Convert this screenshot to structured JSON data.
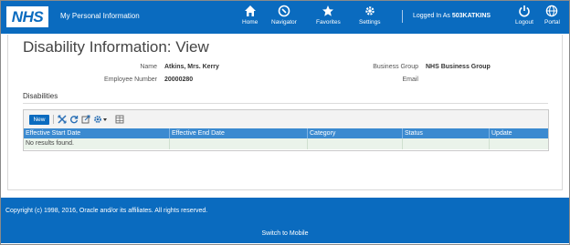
{
  "header": {
    "logo_text": "NHS",
    "app_title": "My Personal Information",
    "nav": [
      {
        "label": "Home",
        "icon": "home-icon"
      },
      {
        "label": "Navigator",
        "icon": "navigator-icon"
      },
      {
        "label": "Favorites",
        "icon": "favorites-star-icon"
      },
      {
        "label": "Settings",
        "icon": "settings-gear-icon"
      }
    ],
    "logged_in_prefix": "Logged In As",
    "username": "503KATKINS",
    "logout_label": "Logout",
    "portal_label": "Portal"
  },
  "page": {
    "title": "Disability Information: View",
    "fields": {
      "name_label": "Name",
      "name_value": "Atkins, Mrs. Kerry",
      "employee_number_label": "Employee Number",
      "employee_number_value": "20000280",
      "business_group_label": "Business Group",
      "business_group_value": "NHS Business Group",
      "email_label": "Email",
      "email_value": ""
    },
    "section_title": "Disabilities",
    "toolbar": {
      "new_label": "New",
      "icons": [
        "detach-icon",
        "refresh-icon",
        "export-icon",
        "actions-gear-icon",
        "columns-icon"
      ]
    },
    "table": {
      "columns": [
        "Effective Start Date",
        "Effective End Date",
        "Category",
        "Status",
        "Update"
      ],
      "empty_message": "No results found."
    }
  },
  "footer": {
    "copyright": "Copyright (c) 1998, 2016, Oracle and/or its affiliates. All rights reserved.",
    "switch_label": "Switch to Mobile"
  },
  "colors": {
    "brand_blue": "#0a6bbf",
    "table_header": "#3b8ad0"
  }
}
